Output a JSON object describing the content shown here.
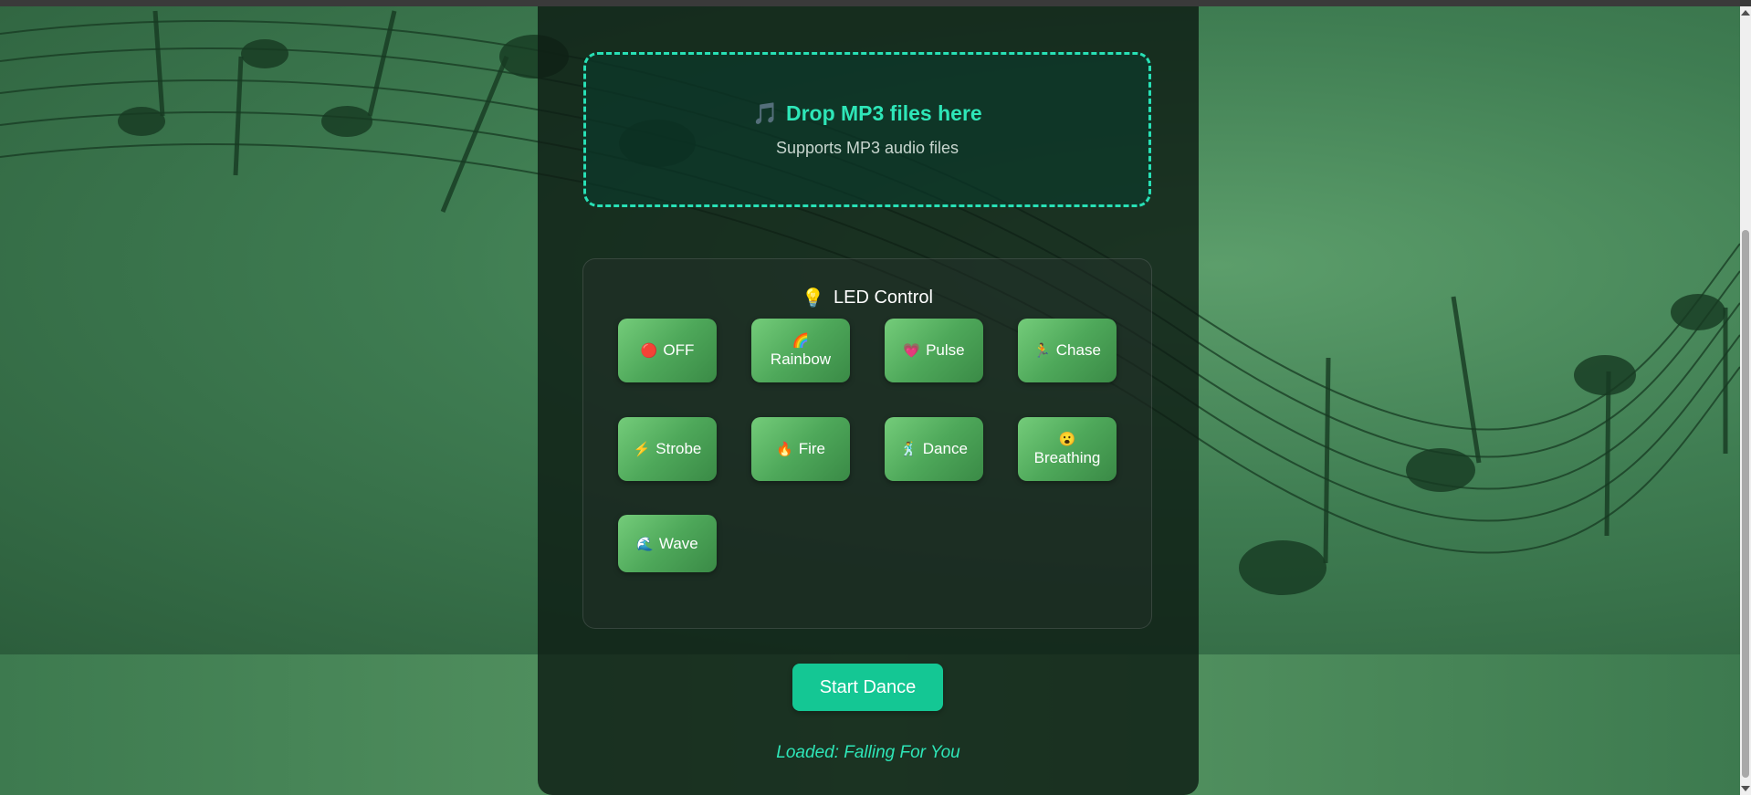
{
  "dropzone": {
    "icon": "music-note-icon",
    "title": "Drop MP3 files here",
    "subtitle": "Supports MP3 audio files"
  },
  "led_control": {
    "title": "LED Control",
    "icon": "lightbulb-icon",
    "buttons": [
      {
        "label": "OFF",
        "icon": "red-circle-icon",
        "glyph": "🔴"
      },
      {
        "label": "Rainbow",
        "icon": "rainbow-icon",
        "glyph": "🌈"
      },
      {
        "label": "Pulse",
        "icon": "heart-icon",
        "glyph": "💗"
      },
      {
        "label": "Chase",
        "icon": "running-icon",
        "glyph": "🏃"
      },
      {
        "label": "Strobe",
        "icon": "lightning-icon",
        "glyph": "⚡"
      },
      {
        "label": "Fire",
        "icon": "fire-icon",
        "glyph": "🔥"
      },
      {
        "label": "Dance",
        "icon": "dancer-icon",
        "glyph": "🕺"
      },
      {
        "label": "Breathing",
        "icon": "face-exhaling-icon",
        "glyph": "😮"
      },
      {
        "label": "Wave",
        "icon": "wave-icon",
        "glyph": "🌊"
      }
    ]
  },
  "start_button": {
    "label": "Start Dance"
  },
  "status": {
    "text": "Loaded: Falling For You"
  },
  "colors": {
    "accent": "#2ee6b8",
    "start_button": "#14c794",
    "led_button": "#5cb865",
    "panel": "#0e1c14"
  }
}
